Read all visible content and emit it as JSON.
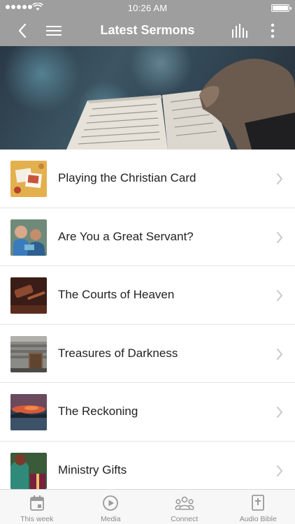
{
  "status_bar": {
    "time": "10:26 AM"
  },
  "navbar": {
    "title": "Latest Sermons",
    "icons": {
      "back": "back-chevron-icon",
      "menu": "hamburger-menu-icon",
      "audio": "audio-bars-icon",
      "more": "more-vertical-icon"
    }
  },
  "hero": {
    "image": "open-bible-photo"
  },
  "sermons": [
    {
      "title": "Playing the Christian Card",
      "thumb": "cards-photo"
    },
    {
      "title": "Are You a Great Servant?",
      "thumb": "people-photo"
    },
    {
      "title": "The Courts of Heaven",
      "thumb": "gavel-photo"
    },
    {
      "title": "Treasures of Darkness",
      "thumb": "vault-photo"
    },
    {
      "title": "The Reckoning",
      "thumb": "sunset-photo"
    },
    {
      "title": "Ministry Gifts",
      "thumb": "gift-photo"
    }
  ],
  "tabbar": {
    "tabs": [
      {
        "label": "This week",
        "icon": "calendar-icon"
      },
      {
        "label": "Media",
        "icon": "play-circle-icon"
      },
      {
        "label": "Connect",
        "icon": "group-icon"
      },
      {
        "label": "Audio Bible",
        "icon": "bible-icon"
      }
    ]
  },
  "colors": {
    "header_bg": "#9e9e9e",
    "tabbar_bg": "#f7f7f7",
    "tab_icon": "#9a9a9a",
    "chevron": "#c8c8c8"
  }
}
